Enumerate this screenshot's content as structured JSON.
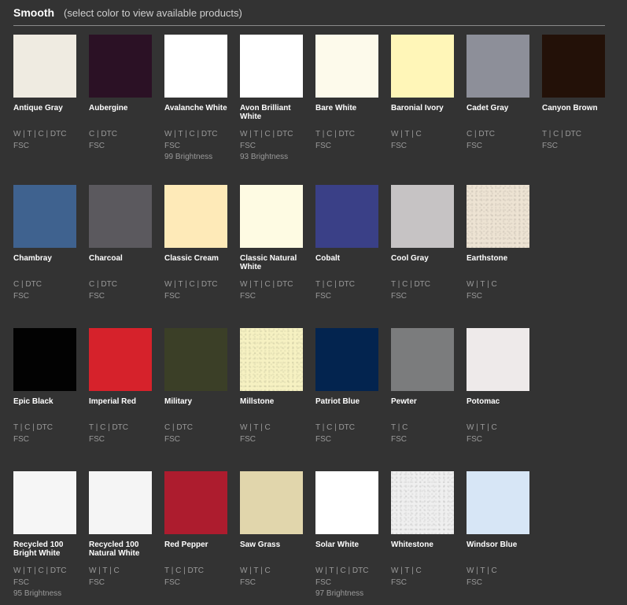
{
  "header": {
    "title": "Smooth",
    "subtitle": "(select color to view available products)"
  },
  "rows": [
    [
      {
        "name": "Antique Gray",
        "color": "#efebe1",
        "specs": [
          "W | T | C | DTC",
          "FSC"
        ]
      },
      {
        "name": "Aubergine",
        "color": "#2b1125",
        "specs": [
          "C | DTC",
          "FSC"
        ]
      },
      {
        "name": "Avalanche White",
        "color": "#ffffff",
        "specs": [
          "W | T | C | DTC",
          "FSC",
          "99 Brightness"
        ]
      },
      {
        "name": "Avon Brilliant White",
        "color": "#ffffff",
        "specs": [
          "W | T | C | DTC",
          "FSC",
          "93 Brightness"
        ]
      },
      {
        "name": "Bare White",
        "color": "#fdfaeb",
        "specs": [
          "T | C | DTC",
          "FSC"
        ]
      },
      {
        "name": "Baronial Ivory",
        "color": "#fff6b8",
        "specs": [
          "W | T | C",
          "FSC"
        ]
      },
      {
        "name": "Cadet Gray",
        "color": "#8d8f99",
        "specs": [
          "C | DTC",
          "FSC"
        ]
      },
      {
        "name": "Canyon Brown",
        "color": "#231108",
        "specs": [
          "T | C | DTC",
          "FSC"
        ]
      }
    ],
    [
      {
        "name": "Chambray",
        "color": "#3f628f",
        "specs": [
          "C | DTC",
          "FSC"
        ]
      },
      {
        "name": "Charcoal",
        "color": "#5b595e",
        "specs": [
          "C | DTC",
          "FSC"
        ]
      },
      {
        "name": "Classic Cream",
        "color": "#feeab8",
        "specs": [
          "W | T | C | DTC",
          "FSC"
        ]
      },
      {
        "name": "Classic Natural White",
        "color": "#fefbe3",
        "specs": [
          "W | T | C | DTC",
          "FSC"
        ]
      },
      {
        "name": "Cobalt",
        "color": "#3a4087",
        "specs": [
          "T | C | DTC",
          "FSC"
        ]
      },
      {
        "name": "Cool Gray",
        "color": "#c6c3c4",
        "specs": [
          "T | C | DTC",
          "FSC"
        ]
      },
      {
        "name": "Earthstone",
        "color": "#ede3d3",
        "speckle": true,
        "specs": [
          "W | T | C",
          "FSC"
        ]
      }
    ],
    [
      {
        "name": "Epic Black",
        "color": "#020202",
        "specs": [
          "T | C | DTC",
          "FSC"
        ]
      },
      {
        "name": "Imperial Red",
        "color": "#d6222b",
        "specs": [
          "T | C | DTC",
          "FSC"
        ]
      },
      {
        "name": "Military",
        "color": "#3b3f27",
        "specs": [
          "C | DTC",
          "FSC"
        ]
      },
      {
        "name": "Millstone",
        "color": "#f6f1c2",
        "speckle": true,
        "specs": [
          "W | T | C",
          "FSC"
        ]
      },
      {
        "name": "Patriot Blue",
        "color": "#03244f",
        "specs": [
          "T | C | DTC",
          "FSC"
        ]
      },
      {
        "name": "Pewter",
        "color": "#7b7c7d",
        "specs": [
          "T | C",
          "FSC"
        ]
      },
      {
        "name": "Potomac",
        "color": "#eeeaea",
        "specs": [
          "W | T | C",
          "FSC"
        ]
      }
    ],
    [
      {
        "name": "Recycled 100 Bright White",
        "color": "#f6f6f6",
        "specs": [
          "W | T | C | DTC",
          "FSC",
          "95 Brightness"
        ]
      },
      {
        "name": "Recycled 100 Natural White",
        "color": "#f5f5f5",
        "specs": [
          "W | T | C",
          "FSC"
        ]
      },
      {
        "name": "Red Pepper",
        "color": "#ad1c2e",
        "specs": [
          "T | C | DTC",
          "FSC"
        ]
      },
      {
        "name": "Saw Grass",
        "color": "#e1d6ac",
        "specs": [
          "W | T | C",
          "FSC"
        ]
      },
      {
        "name": "Solar White",
        "color": "#ffffff",
        "specs": [
          "W | T | C | DTC",
          "FSC",
          "97 Brightness"
        ]
      },
      {
        "name": "Whitestone",
        "color": "#efefef",
        "speckle": true,
        "specs": [
          "W | T | C",
          "FSC"
        ]
      },
      {
        "name": "Windsor Blue",
        "color": "#d7e6f6",
        "specs": [
          "W | T | C",
          "FSC"
        ]
      }
    ]
  ]
}
